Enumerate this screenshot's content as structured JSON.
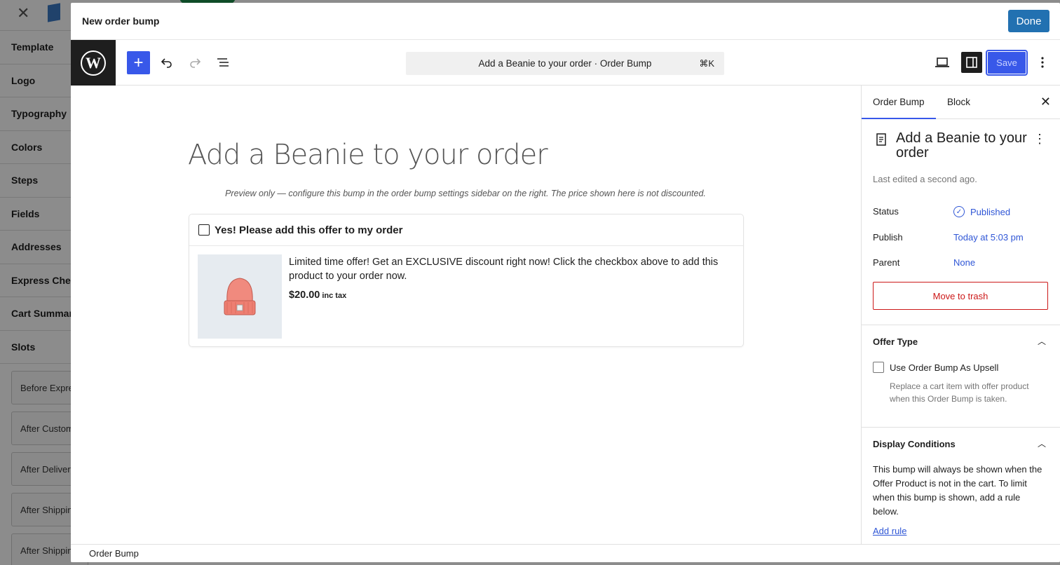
{
  "background": {
    "close_glyph": "✕",
    "sidebar_items": [
      "Template",
      "Logo",
      "Typography",
      "Colors",
      "Steps",
      "Fields",
      "Addresses",
      "Express Checkout",
      "Cart Summary",
      "Slots"
    ],
    "slots": [
      "Before Express Checkout",
      "After Customer",
      "After Delivery",
      "After Shipping",
      "After Shipping"
    ]
  },
  "modal": {
    "title": "New order bump",
    "done_label": "Done"
  },
  "toolbar": {
    "add_glyph": "+",
    "command_text": "Add a Beanie to your order · Order Bump",
    "command_shortcut": "⌘K",
    "save_label": "Save"
  },
  "canvas": {
    "post_title": "Add a Beanie to your order",
    "preview_note": "Preview only — configure this bump in the order bump settings sidebar on the right. The price shown here is not discounted.",
    "bump": {
      "checkbox_label": "Yes! Please add this offer to my order",
      "description": "Limited time offer! Get an EXCLUSIVE discount right now! Click the checkbox above to add this product to your order now.",
      "price": "$20.00",
      "tax_label": "inc tax"
    }
  },
  "sidebar": {
    "tabs": [
      "Order Bump",
      "Block"
    ],
    "post_title": "Add a Beanie to your order",
    "last_edited": "Last edited a second ago.",
    "status_label": "Status",
    "status_value": "Published",
    "publish_label": "Publish",
    "publish_value": "Today at 5:03 pm",
    "parent_label": "Parent",
    "parent_value": "None",
    "trash_label": "Move to trash",
    "offer_type": {
      "title": "Offer Type",
      "checkbox_label": "Use Order Bump As Upsell",
      "help": "Replace a cart item with offer product when this Order Bump is taken."
    },
    "display_conditions": {
      "title": "Display Conditions",
      "text": "This bump will always be shown when the Offer Product is not in the cart. To limit when this bump is shown, add a rule below.",
      "add_rule": "Add rule"
    }
  },
  "footer": {
    "breadcrumb": "Order Bump"
  },
  "colors": {
    "accent": "#3858e9",
    "done_button": "#2271b1",
    "danger": "#cc1818",
    "link": "#2f56d6"
  }
}
